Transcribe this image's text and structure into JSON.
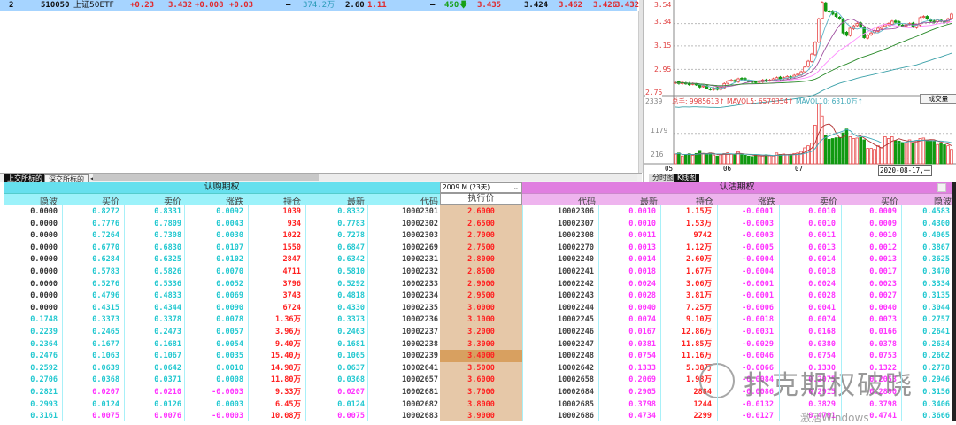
{
  "quote": {
    "idx": "2",
    "code": "510050",
    "name": "上证50ETF",
    "chg": "+0.23",
    "price": "3.432",
    "chg_abs": "+0.008",
    "chg2": "+0.03",
    "dash1": "–",
    "volume": "374.2万",
    "f1": "2.60",
    "f2": "1.11",
    "dash2": "–",
    "vol_now": "450",
    "vol_arrow": "🡇",
    "bid": "3.435",
    "open": "3.424",
    "high": "3.462",
    "low": "3.426",
    "last": "3.432"
  },
  "bottom_tabs": [
    "上交所标的",
    "深交所标的"
  ],
  "scroll_left_arrow": "◂",
  "chart": {
    "price_ticks": [
      "3.54",
      "3.34",
      "3.15",
      "2.95",
      "2.75"
    ],
    "vol_ticks": [
      "2339",
      "1179",
      "216"
    ],
    "vol_header": {
      "total": "总手: 9985613↑",
      "mavol5": "MAVOL5: 6579354↑",
      "mavol10": "MAVOL10: 631.0万↑"
    },
    "vol_button": "成交量",
    "x_labels": [
      "05",
      "06",
      "07"
    ],
    "cursor_date": "2020-08-17,一",
    "tabs": [
      "分时图",
      "K线图"
    ],
    "colors": {
      "up": "#e84848",
      "down": "#119911",
      "ma5": "#5fb4c8",
      "ma10": "#a050a0",
      "ma20": "#ff88ff",
      "ma60": "#2a8a2a",
      "ma120": "#3aa0a8"
    },
    "closes": [
      2.84,
      2.83,
      2.84,
      2.83,
      2.82,
      2.83,
      2.82,
      2.8,
      2.81,
      2.79,
      2.78,
      2.79,
      2.78,
      2.8,
      2.83,
      2.85,
      2.86,
      2.85,
      2.87,
      2.87,
      2.86,
      2.85,
      2.84,
      2.84,
      2.85,
      2.86,
      2.85,
      2.86,
      2.87,
      2.88,
      2.87,
      2.88,
      2.89,
      2.88,
      2.9,
      2.91,
      2.93,
      2.97,
      3.02,
      3.08,
      3.18,
      3.38,
      3.52,
      3.45,
      3.44,
      3.42,
      3.4,
      3.38,
      3.26,
      3.24,
      3.3,
      3.32,
      3.34,
      3.31,
      3.22,
      3.24,
      3.26,
      3.28,
      3.3,
      3.31,
      3.33,
      3.34,
      3.36,
      3.35,
      3.33,
      3.32,
      3.33,
      3.34,
      3.31,
      3.33,
      3.39,
      3.4,
      3.38,
      3.36,
      3.35,
      3.37,
      3.36,
      3.35,
      3.38,
      3.42
    ],
    "volumes": [
      380,
      420,
      300,
      350,
      390,
      330,
      400,
      520,
      380,
      360,
      420,
      340,
      300,
      350,
      400,
      430,
      380,
      360,
      470,
      350,
      330,
      300,
      280,
      340,
      320,
      300,
      350,
      310,
      300,
      420,
      360,
      380,
      340,
      330,
      400,
      420,
      480,
      620,
      700,
      800,
      1500,
      2339,
      1850,
      1100,
      950,
      980,
      1010,
      1020,
      1200,
      1350,
      1050,
      980,
      1000,
      1020,
      930,
      600,
      600,
      560,
      700,
      620,
      1050,
      980,
      1050,
      900,
      880,
      830,
      820,
      930,
      800,
      900,
      980,
      1000,
      920,
      900,
      870,
      750,
      780,
      740,
      700,
      560
    ]
  },
  "options": {
    "call_title": "认购期权",
    "put_title": "认沽期权",
    "expiry_select": "2009 M (23天)",
    "call_headers": [
      "隐波",
      "买价",
      "卖价",
      "涨跌",
      "持仓",
      "最新",
      "代码"
    ],
    "strike_header": "执行价",
    "put_headers": [
      "代码",
      "最新",
      "持仓",
      "涨跌",
      "卖价",
      "买价",
      "隐波"
    ],
    "highlight_strike": "3.4000",
    "rows": [
      {
        "call": [
          "0.0000",
          "0.8272",
          "0.8331",
          "0.0092",
          "1039",
          "0.8332",
          "10002301"
        ],
        "strike": "2.6000",
        "put": [
          "10002306",
          "0.0010",
          "1.15万",
          "-0.0001",
          "0.0010",
          "0.0009",
          "0.4583"
        ]
      },
      {
        "call": [
          "0.0000",
          "0.7776",
          "0.7809",
          "0.0043",
          "934",
          "0.7783",
          "10002302"
        ],
        "strike": "2.6500",
        "put": [
          "10002307",
          "0.0010",
          "1.53万",
          "-0.0003",
          "0.0010",
          "0.0009",
          "0.4300"
        ]
      },
      {
        "call": [
          "0.0000",
          "0.7264",
          "0.7308",
          "0.0030",
          "1022",
          "0.7278",
          "10002303"
        ],
        "strike": "2.7000",
        "put": [
          "10002308",
          "0.0011",
          "9742",
          "-0.0003",
          "0.0011",
          "0.0010",
          "0.4065"
        ]
      },
      {
        "call": [
          "0.0000",
          "0.6770",
          "0.6830",
          "0.0107",
          "1550",
          "0.6847",
          "10002269"
        ],
        "strike": "2.7500",
        "put": [
          "10002270",
          "0.0013",
          "1.12万",
          "-0.0005",
          "0.0013",
          "0.0012",
          "0.3867"
        ]
      },
      {
        "call": [
          "0.0000",
          "0.6284",
          "0.6325",
          "0.0102",
          "2847",
          "0.6342",
          "10002231"
        ],
        "strike": "2.8000",
        "put": [
          "10002240",
          "0.0014",
          "2.60万",
          "-0.0004",
          "0.0014",
          "0.0013",
          "0.3625"
        ]
      },
      {
        "call": [
          "0.0000",
          "0.5783",
          "0.5826",
          "0.0070",
          "4711",
          "0.5810",
          "10002232"
        ],
        "strike": "2.8500",
        "put": [
          "10002241",
          "0.0018",
          "1.67万",
          "-0.0004",
          "0.0018",
          "0.0017",
          "0.3470"
        ]
      },
      {
        "call": [
          "0.0000",
          "0.5276",
          "0.5336",
          "0.0052",
          "3796",
          "0.5292",
          "10002233"
        ],
        "strike": "2.9000",
        "put": [
          "10002242",
          "0.0024",
          "3.06万",
          "-0.0001",
          "0.0024",
          "0.0023",
          "0.3334"
        ]
      },
      {
        "call": [
          "0.0000",
          "0.4796",
          "0.4833",
          "0.0069",
          "3743",
          "0.4818",
          "10002234"
        ],
        "strike": "2.9500",
        "put": [
          "10002243",
          "0.0028",
          "3.81万",
          "-0.0001",
          "0.0028",
          "0.0027",
          "0.3135"
        ]
      },
      {
        "call": [
          "0.0000",
          "0.4315",
          "0.4344",
          "0.0090",
          "6724",
          "0.4330",
          "10002235"
        ],
        "strike": "3.0000",
        "put": [
          "10002244",
          "0.0040",
          "7.25万",
          "-0.0006",
          "0.0041",
          "0.0040",
          "0.3044"
        ]
      },
      {
        "call": [
          "0.1748",
          "0.3373",
          "0.3378",
          "0.0078",
          "1.36万",
          "0.3373",
          "10002236"
        ],
        "strike": "3.1000",
        "put": [
          "10002245",
          "0.0074",
          "9.10万",
          "-0.0018",
          "0.0074",
          "0.0073",
          "0.2757"
        ]
      },
      {
        "call": [
          "0.2239",
          "0.2465",
          "0.2473",
          "0.0057",
          "3.96万",
          "0.2463",
          "10002237"
        ],
        "strike": "3.2000",
        "put": [
          "10002246",
          "0.0167",
          "12.86万",
          "-0.0031",
          "0.0168",
          "0.0166",
          "0.2641"
        ]
      },
      {
        "call": [
          "0.2364",
          "0.1677",
          "0.1681",
          "0.0054",
          "9.40万",
          "0.1681",
          "10002238"
        ],
        "strike": "3.3000",
        "put": [
          "10002247",
          "0.0381",
          "11.85万",
          "-0.0029",
          "0.0380",
          "0.0378",
          "0.2634"
        ]
      },
      {
        "call": [
          "0.2476",
          "0.1063",
          "0.1067",
          "0.0035",
          "15.40万",
          "0.1065",
          "10002239"
        ],
        "strike": "3.4000",
        "put": [
          "10002248",
          "0.0754",
          "11.16万",
          "-0.0046",
          "0.0754",
          "0.0753",
          "0.2662"
        ]
      },
      {
        "call": [
          "0.2592",
          "0.0639",
          "0.0642",
          "0.0010",
          "14.98万",
          "0.0637",
          "10002641"
        ],
        "strike": "3.5000",
        "put": [
          "10002642",
          "0.1333",
          "5.38万",
          "-0.0066",
          "0.1330",
          "0.1322",
          "0.2778"
        ]
      },
      {
        "call": [
          "0.2706",
          "0.0368",
          "0.0371",
          "0.0008",
          "11.80万",
          "0.0368",
          "10002657"
        ],
        "strike": "3.6000",
        "put": [
          "10002658",
          "0.2069",
          "1.98万",
          "-0.0084",
          "0.2075",
          "0.2053",
          "0.2946"
        ]
      },
      {
        "call": [
          "0.2821",
          "0.0207",
          "0.0210",
          "-0.0003",
          "9.33万",
          "0.0207",
          "10002681"
        ],
        "strike": "3.7000",
        "put": [
          "10002684",
          "0.2905",
          "2884",
          "-0.0086",
          "0.2915",
          "0.2890",
          "0.3156"
        ]
      },
      {
        "call": [
          "0.2993",
          "0.0124",
          "0.0126",
          "0.0003",
          "6.45万",
          "0.0124",
          "10002682"
        ],
        "strike": "3.8000",
        "put": [
          "10002685",
          "0.3798",
          "1244",
          "-0.0132",
          "0.3829",
          "0.3798",
          "0.3406"
        ]
      },
      {
        "call": [
          "0.3161",
          "0.0075",
          "0.0076",
          "-0.0003",
          "10.08万",
          "0.0075",
          "10002683"
        ],
        "strike": "3.9000",
        "put": [
          "10002686",
          "0.4734",
          "2299",
          "-0.0127",
          "0.4781",
          "0.4741",
          "0.3666"
        ]
      }
    ]
  },
  "watermark": {
    "brand": "扑克期权破晓",
    "activate": "激活Windows"
  },
  "colors": {
    "call_header": "#66e0ee",
    "call_subheader": "#9cf2fa",
    "put_header": "#e07ee0",
    "put_subheader": "#eeb4ee",
    "strike_bg": "#e6c8a8",
    "strike_highlight": "#d8a060",
    "cyan": "#22c8d0",
    "magenta": "#ff33ff",
    "red": "#ff2020"
  }
}
